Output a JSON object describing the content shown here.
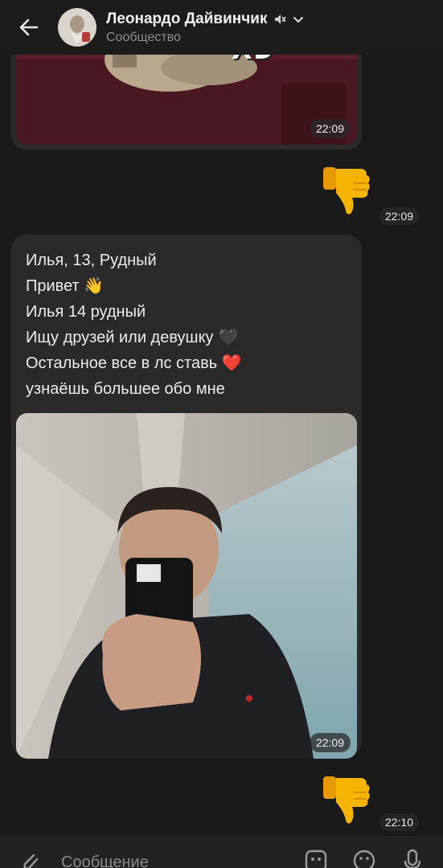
{
  "header": {
    "title": "Леонардо Дайвинчик",
    "subtitle": "Сообщество",
    "back_icon": "arrow-left-icon",
    "mute_icon": "muted-speaker-icon",
    "dropdown_icon": "chevron-down-icon"
  },
  "messages": {
    "top_photo": {
      "overlay_text": "XD",
      "time": "22:09"
    },
    "reaction_1": {
      "emoji": "thumbs-down",
      "time": "22:09"
    },
    "profile": {
      "lines": [
        "Илья, 13, Рудный",
        "Привет 👋",
        "Илья 14 рудный",
        "Ищу друзей или девушку 🖤",
        "Остальное все в лс ставь ❤️",
        "узнаёшь большее обо мне"
      ],
      "photo_time": "22:09"
    },
    "reaction_2": {
      "emoji": "thumbs-down",
      "time": "22:10"
    }
  },
  "input": {
    "placeholder": "Сообщение",
    "attach_icon": "paperclip-icon",
    "keyboard_icon": "bot-keyboard-icon",
    "emoji_icon": "smile-icon",
    "mic_icon": "microphone-icon"
  },
  "colors": {
    "background": "#1a1a1a",
    "bubble": "#2a2a2b",
    "thumb": "#f5b400"
  }
}
